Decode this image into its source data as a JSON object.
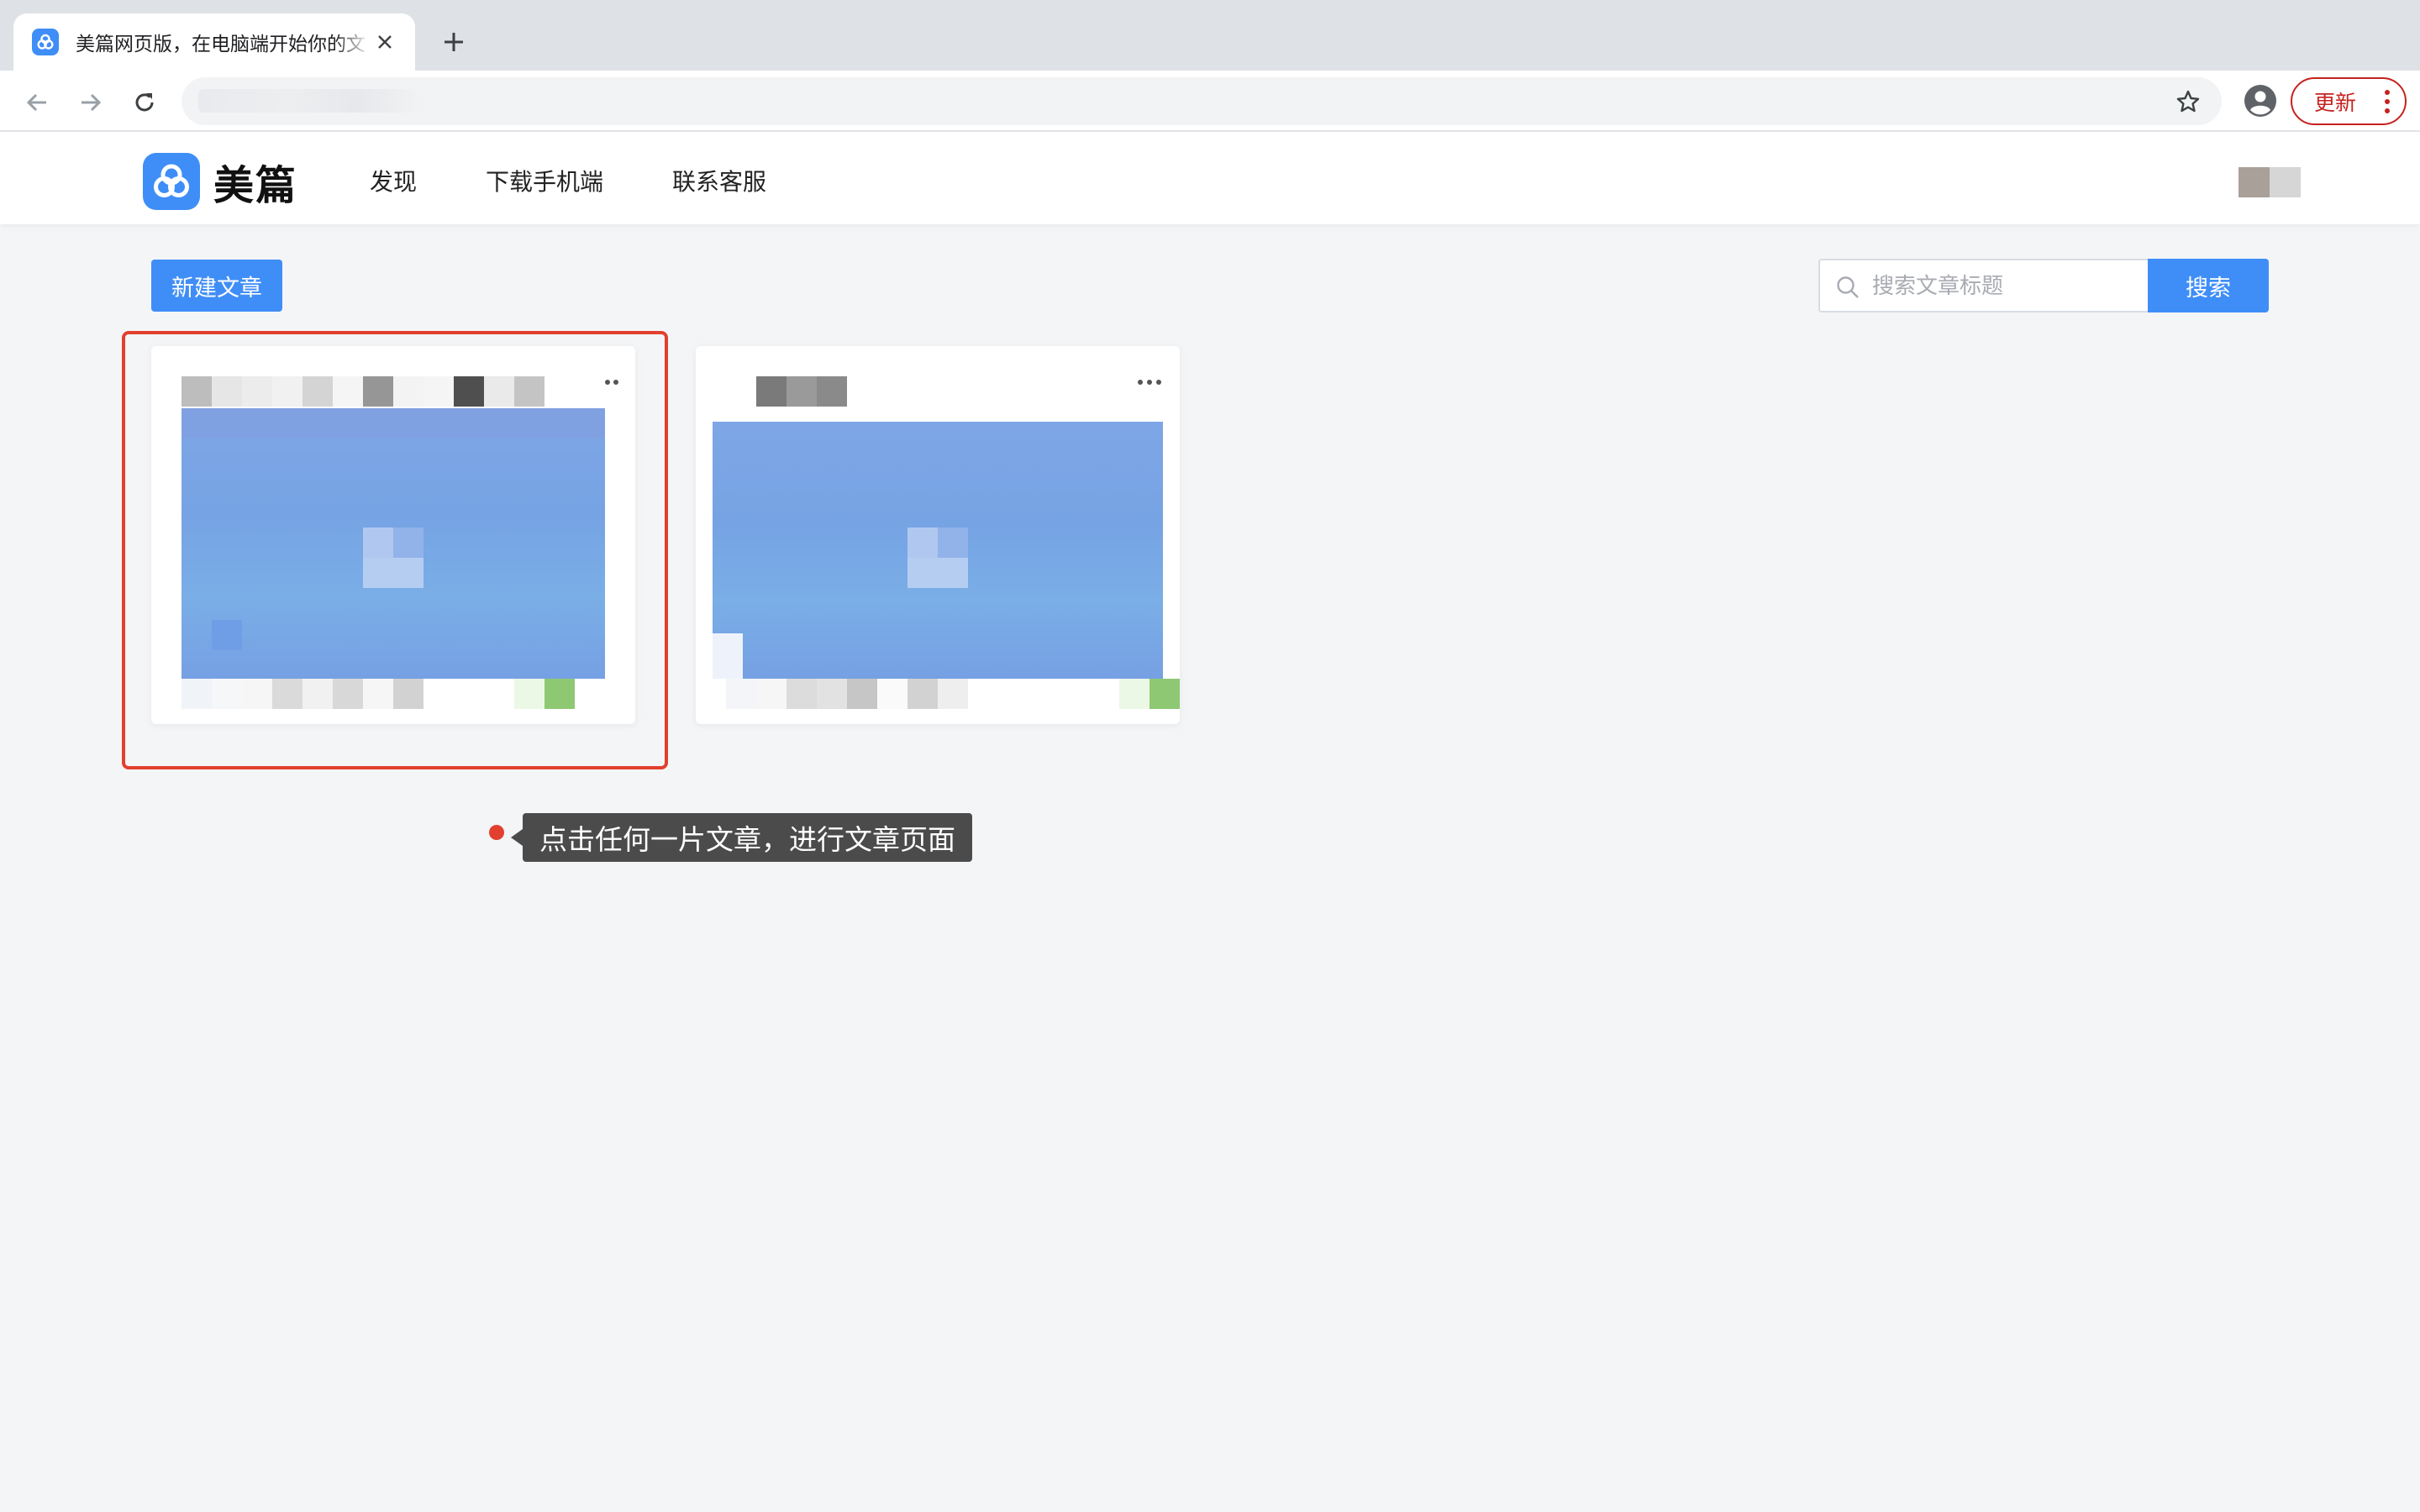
{
  "browser": {
    "tab": {
      "title": "美篇网页版，在电脑端开始你的文"
    },
    "update_label": "更新"
  },
  "site": {
    "logo_text": "美篇",
    "nav": [
      "发现",
      "下载手机端",
      "联系客服"
    ]
  },
  "main": {
    "new_article_label": "新建文章",
    "search": {
      "placeholder": "搜索文章标题",
      "button_label": "搜索"
    }
  },
  "tooltip": {
    "text": "点击任何一片文章，进行文章页面"
  },
  "colors": {
    "accent": "#3f8ef7",
    "highlight": "#e2402f",
    "tooltip_bg": "#4b4b4b",
    "update": "#c5221f"
  },
  "icons": [
    "back-arrow-icon",
    "forward-arrow-icon",
    "reload-icon",
    "bookmark-star-icon",
    "profile-icon",
    "more-vert-icon",
    "search-icon",
    "more-horizontal-icon",
    "close-icon",
    "plus-icon",
    "meipian-logo-icon"
  ]
}
